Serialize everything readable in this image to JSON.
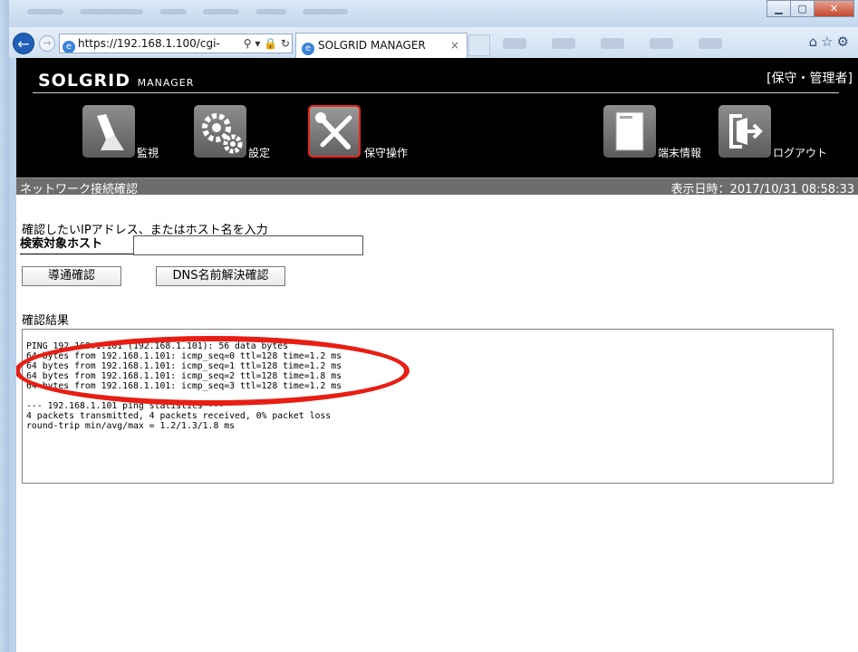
{
  "browser": {
    "address": "https://192.168.1.100/cgi-",
    "tab_title": "SOLGRID MANAGER",
    "tab_close": "×"
  },
  "app": {
    "logo_main": "SOLGRID",
    "logo_sub": "MANAGER",
    "role": "[保守・管理者]",
    "nav": [
      {
        "label": "監視",
        "icon": "flashlight-icon"
      },
      {
        "label": "設定",
        "icon": "gears-icon"
      },
      {
        "label": "保守操作",
        "icon": "tools-icon"
      },
      {
        "label": "端末情報",
        "icon": "device-icon"
      },
      {
        "label": "ログアウト",
        "icon": "logout-icon"
      }
    ],
    "page_title": "ネットワーク接続確認",
    "timestamp": "表示日時：2017/10/31 08:58:33"
  },
  "form": {
    "prompt": "確認したいIPアドレス、またはホスト名を入力",
    "host_label": "検索対象ホスト",
    "host_value": "",
    "ping_button": "導通確認",
    "dns_button": "DNS名前解決確認"
  },
  "result": {
    "label": "確認結果",
    "lines": [
      "PING 192.168.1.101 (192.168.1.101): 56 data bytes",
      "64 bytes from 192.168.1.101: icmp_seq=0 ttl=128 time=1.2 ms",
      "64 bytes from 192.168.1.101: icmp_seq=1 ttl=128 time=1.2 ms",
      "64 bytes from 192.168.1.101: icmp_seq=2 ttl=128 time=1.8 ms",
      "64 bytes from 192.168.1.101: icmp_seq=3 ttl=128 time=1.2 ms",
      "",
      "--- 192.168.1.101 ping statistics ---",
      "4 packets transmitted, 4 packets received, 0% packet loss",
      "round-trip min/avg/max = 1.2/1.3/1.8 ms"
    ]
  },
  "colors": {
    "header_bg": "#000000",
    "status_bg": "#6d6d6d",
    "active_nav_border": "#e8261a",
    "annotation": "#e81e14"
  }
}
